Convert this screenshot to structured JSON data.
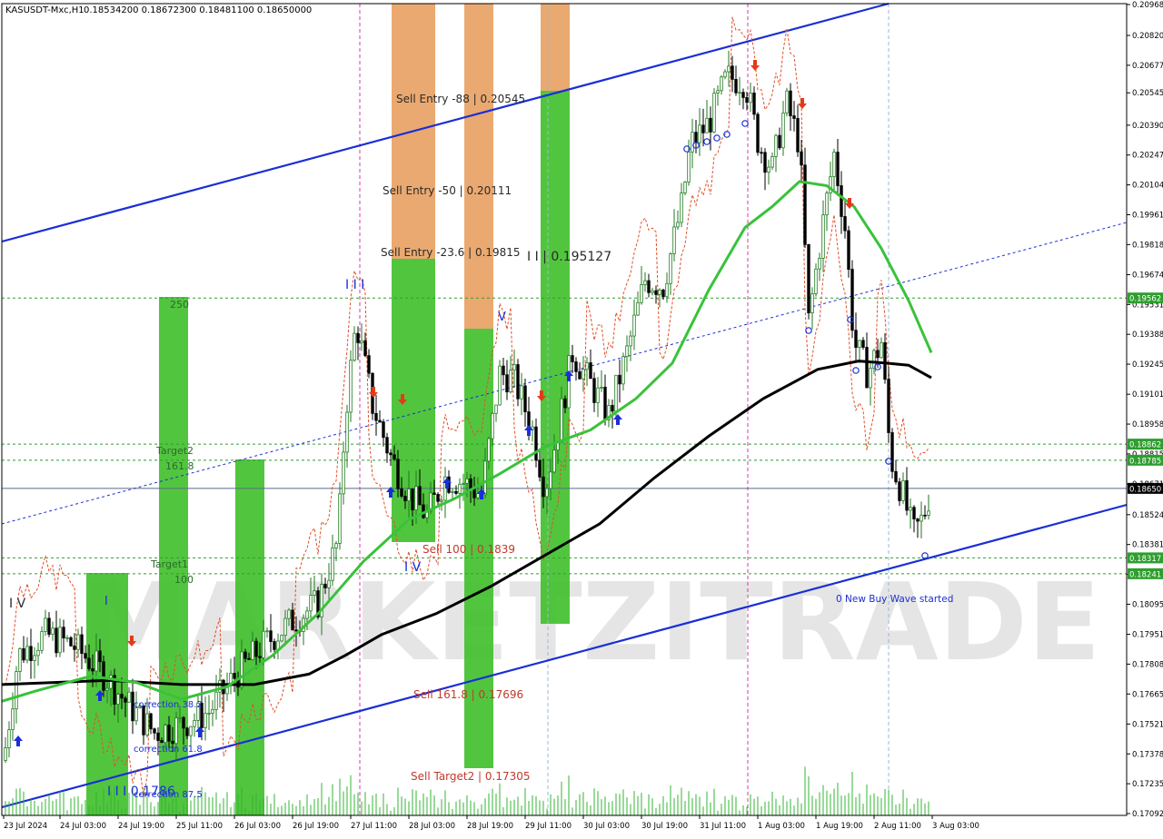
{
  "header": {
    "symbol": "KASUSDT-Mxc,H1",
    "ohlc": "0.18534200 0.18672300 0.18481100 0.18650000"
  },
  "colors": {
    "background": "#ffffff",
    "bull_candle": "#1f7a1f",
    "bear_candle": "#000000",
    "ma_fast": "#39c23a",
    "ma_slow": "#000000",
    "channel": "#1a2fd6",
    "sell_zone_orange": "#e8a060",
    "buy_zone_green": "#3fbf2a",
    "level_line": "#2e9e2e",
    "price_label_bg": "#2e9e2e",
    "current_price_bg": "#000000",
    "annotation_red": "#c0392b",
    "annotation_blue": "#1a2fd6"
  },
  "chart_data": {
    "type": "candlestick",
    "timeframe": "H1",
    "ylim": [
      0.17092,
      0.20968
    ],
    "grid": false,
    "price_axis_ticks": [
      "0.20968",
      "0.20820",
      "0.20677",
      "0.20545",
      "0.20390",
      "0.20247",
      "0.20104",
      "0.19961",
      "0.19818",
      "0.19674",
      "0.19531",
      "0.19388",
      "0.19245",
      "0.19101",
      "0.18958",
      "0.18815",
      "0.18671",
      "0.18524",
      "0.18381",
      "0.18238",
      "0.18095",
      "0.17951",
      "0.17808",
      "0.17665",
      "0.17521",
      "0.17378",
      "0.17235",
      "0.17092"
    ],
    "time_axis_ticks": [
      "23 Jul 2024",
      "24 Jul 03:00",
      "24 Jul 19:00",
      "25 Jul 11:00",
      "26 Jul 03:00",
      "26 Jul 19:00",
      "27 Jul 11:00",
      "28 Jul 03:00",
      "28 Jul 19:00",
      "29 Jul 11:00",
      "30 Jul 03:00",
      "30 Jul 19:00",
      "31 Jul 11:00",
      "1 Aug 03:00",
      "1 Aug 19:00",
      "2 Aug 11:00",
      "3 Aug 03:00"
    ],
    "price_labels": [
      {
        "text": "0.19562",
        "value": 0.19562,
        "kind": "level"
      },
      {
        "text": "0.18862",
        "value": 0.18862,
        "kind": "level"
      },
      {
        "text": "0.18785",
        "value": 0.18785,
        "kind": "level"
      },
      {
        "text": "0.18650",
        "value": 0.1865,
        "kind": "current"
      },
      {
        "text": "0.18317",
        "value": 0.18317,
        "kind": "level"
      },
      {
        "text": "0.18241",
        "value": 0.18241,
        "kind": "level"
      }
    ],
    "annotations": [
      {
        "text": "Sell Entry -88 | 0.20545",
        "color": "dark"
      },
      {
        "text": "Sell Entry -50 | 0.20111",
        "color": "dark"
      },
      {
        "text": "Sell Entry -23.6 | 0.19815",
        "color": "dark"
      },
      {
        "text": "I I | 0.195127",
        "color": "dark"
      },
      {
        "text": "Sell 100 | 0.1839",
        "color": "red"
      },
      {
        "text": "Sell 161.8 | 0.17696",
        "color": "red"
      },
      {
        "text": "Sell Target2 | 0.17305",
        "color": "red"
      },
      {
        "text": "0 New Buy Wave started",
        "color": "blue"
      },
      {
        "text": "Target2",
        "color": "green"
      },
      {
        "text": "161.8",
        "color": "green"
      },
      {
        "text": "Target1",
        "color": "green"
      },
      {
        "text": "100",
        "color": "green"
      },
      {
        "text": "250",
        "color": "green"
      },
      {
        "text": "correction 38.2",
        "color": "blue"
      },
      {
        "text": "correction 61.8",
        "color": "blue"
      },
      {
        "text": "correction 87.5",
        "color": "blue"
      },
      {
        "text": "I I I  0.1786",
        "color": "blue"
      },
      {
        "text": "I I I",
        "color": "blue"
      },
      {
        "text": "I V",
        "color": "blue"
      },
      {
        "text": "I V",
        "color": "dark"
      },
      {
        "text": "V",
        "color": "blue"
      },
      {
        "text": "I",
        "color": "blue"
      }
    ],
    "watermark": "MARKETZITRADE"
  }
}
